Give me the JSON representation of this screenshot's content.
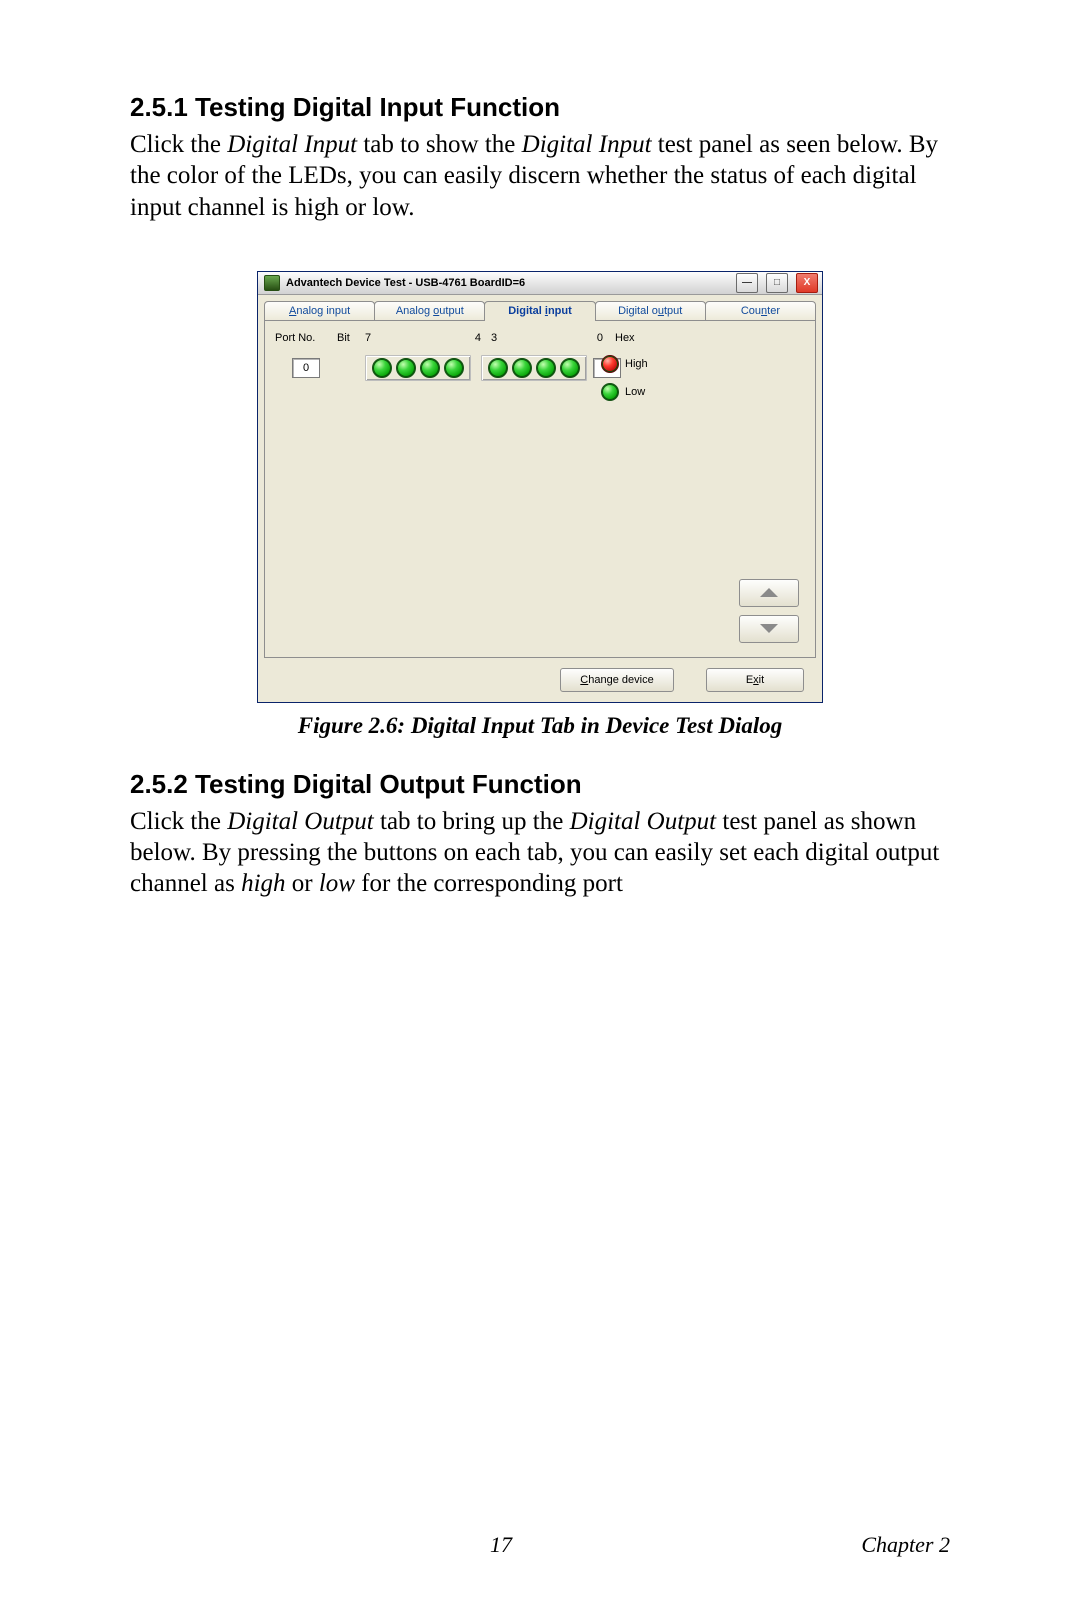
{
  "section251": {
    "heading": "2.5.1 Testing Digital Input Function",
    "para_pre": "Click the ",
    "para_it1": "Digital Input",
    "para_mid1": " tab to show the ",
    "para_it2": "Digital Input",
    "para_post": " test panel as seen below. By the color of the LEDs, you can easily discern whether the status of each digital input channel is high or low."
  },
  "figure_caption": "Figure 2.6: Digital Input Tab in Device Test Dialog",
  "section252": {
    "heading": "2.5.2 Testing Digital Output Function",
    "para_pre": "Click the ",
    "para_it1": "Digital Output",
    "para_mid1": " tab to bring up the ",
    "para_it2": "Digital Output",
    "para_mid2": " test panel as shown below. By pressing the buttons on each tab, you can easily set each digital output channel as ",
    "para_it3": "high",
    "para_mid3": " or ",
    "para_it4": "low",
    "para_post": " for the corresponding port"
  },
  "footer": {
    "page": "17",
    "chapter": "Chapter 2"
  },
  "win": {
    "title": "Advantech Device Test - USB-4761 BoardID=6",
    "tabs": {
      "analog_input": "Analog input",
      "analog_output": "Analog output",
      "digital_input": "Digital input",
      "digital_output": "Digital output",
      "counter": "Counter"
    },
    "headers": {
      "port_no": "Port No.",
      "bit": "Bit",
      "b7": "7",
      "b4": "4",
      "b3": "3",
      "b0": "0",
      "hex": "Hex"
    },
    "port_value": "0",
    "hex_value": "0",
    "legend": {
      "high": "High",
      "low": "Low"
    },
    "buttons": {
      "change_device": "Change device",
      "exit": "Exit"
    },
    "winbtn": {
      "min": "—",
      "max": "□",
      "close": "X"
    }
  }
}
